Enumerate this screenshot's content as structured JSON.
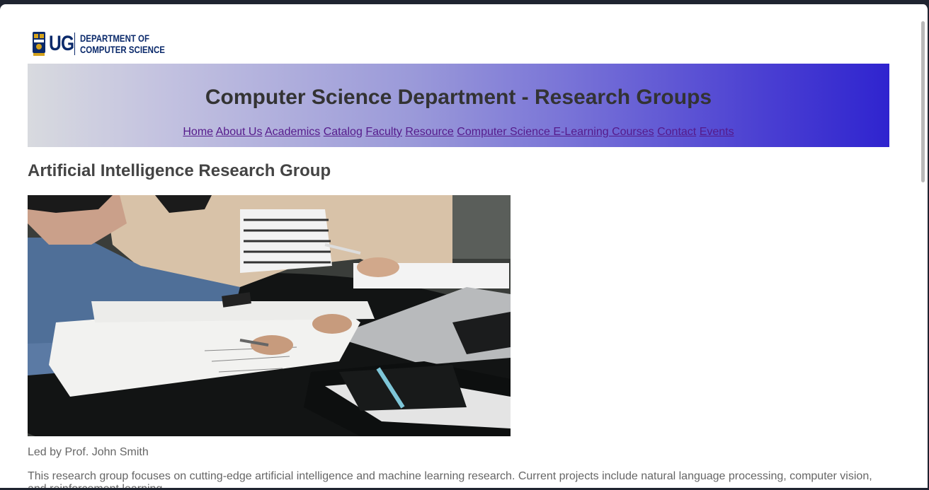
{
  "logo": {
    "abbr": "UG",
    "line1": "DEPARTMENT OF",
    "line2": "COMPUTER SCIENCE"
  },
  "header": {
    "title": "Computer Science Department - Research Groups"
  },
  "nav": {
    "items": [
      "Home",
      "About Us",
      "Academics",
      "Catalog",
      "Faculty",
      "Resource",
      "Computer Science E-Learning Courses",
      "Contact",
      "Events"
    ]
  },
  "group": {
    "title": "Artificial Intelligence Research Group",
    "led_by": "Led by Prof. John Smith",
    "description": "This research group focuses on cutting-edge artificial intelligence and machine learning research. Current projects include natural language processing, computer vision, and reinforcement learning."
  },
  "colors": {
    "banner_start": "#d8dadf",
    "banner_end": "#2f24cf",
    "link": "#551a8b",
    "heading": "#333333",
    "body_text": "#666666"
  }
}
